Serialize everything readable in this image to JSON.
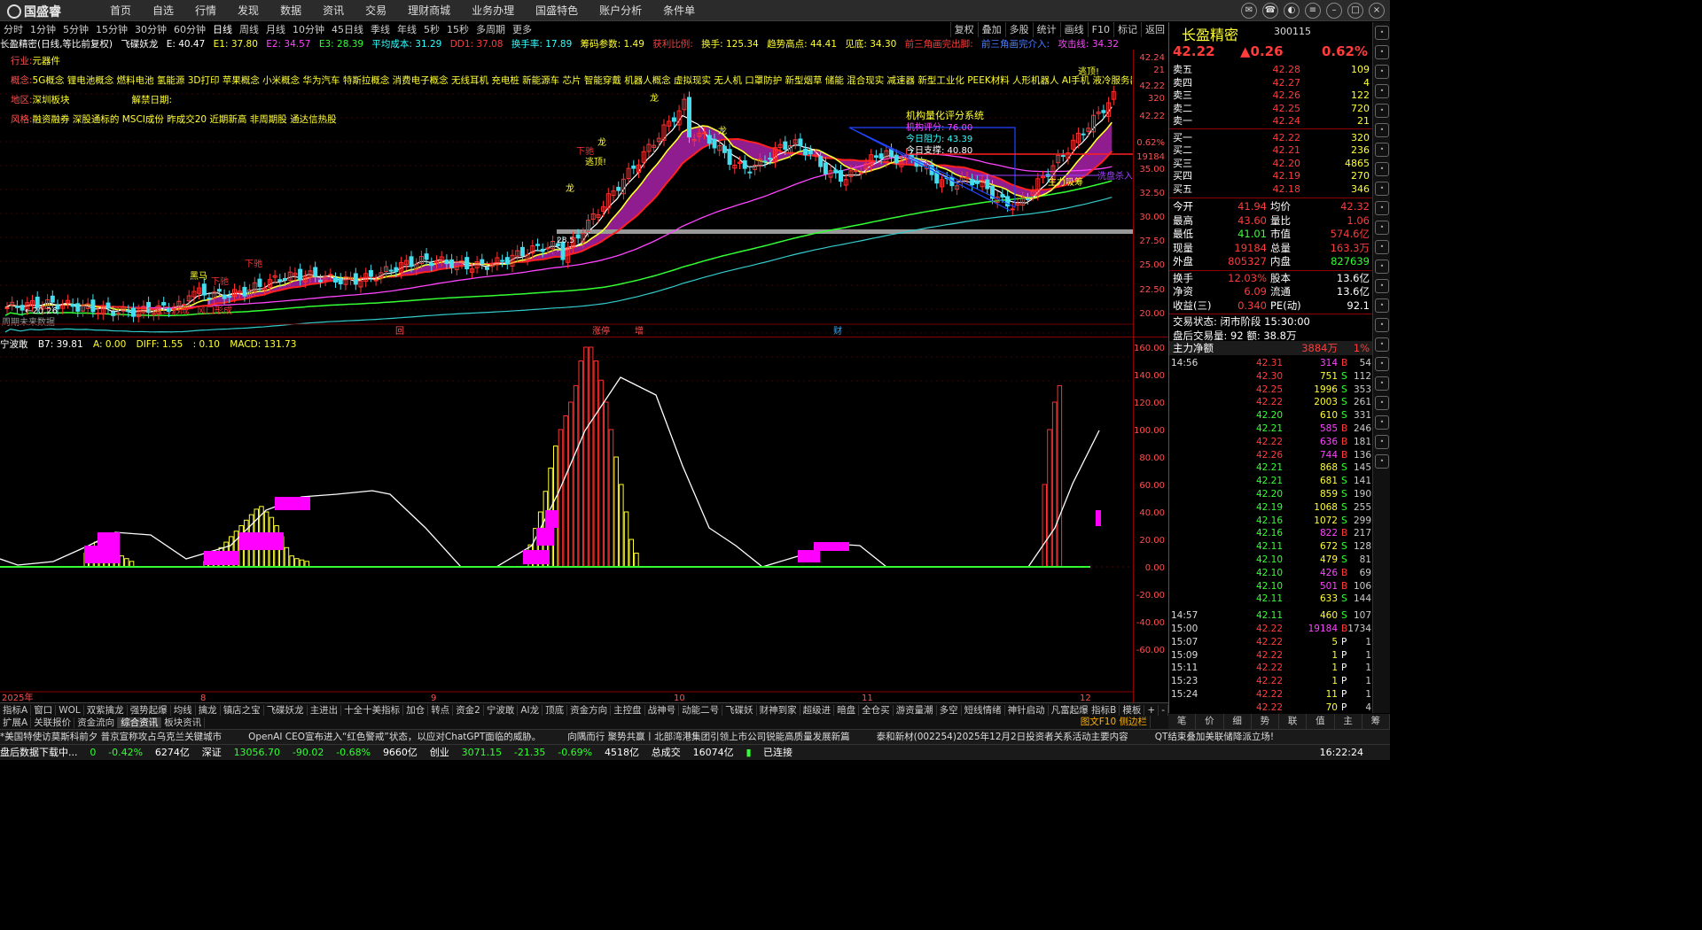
{
  "app": {
    "logo": "国盛睿"
  },
  "menu": [
    "首页",
    "自选",
    "行情",
    "发现",
    "数据",
    "资讯",
    "交易",
    "理财商城",
    "业务办理",
    "国盛特色",
    "账户分析",
    "条件单"
  ],
  "periods": [
    "分时",
    "1分钟",
    "5分钟",
    "15分钟",
    "30分钟",
    "60分钟",
    "日线",
    "周线",
    "月线",
    "10分钟",
    "45日线",
    "季线",
    "年线",
    "5秒",
    "15秒",
    "多周期",
    "更多"
  ],
  "active_period": "日线",
  "chart_tools": [
    "复权",
    "叠加",
    "多股",
    "统计",
    "画线",
    "F10",
    "标记",
    "返回"
  ],
  "info": {
    "stock": "长盈精密(日线,等比前复权)",
    "indicator": "飞碟妖龙",
    "e": "E: 40.47",
    "e1": "E1: 37.80",
    "e2": "E2: 34.57",
    "e3": "E3: 28.39",
    "avg_cost": "平均成本: 31.29",
    "dd1": "DD1: 37.08",
    "turnover_rate": "换手率: 17.89",
    "chip": "筹码参数: 1.49",
    "profit": "获利比例:",
    "turnover": "换手: 125.34",
    "trend_high": "趋势高点: 44.41",
    "vision": "见底: 34.30",
    "brk": "前三角画完出脚:",
    "brk2": "前三角画完介入:",
    "attack": "攻击线: 34.32"
  },
  "tags": {
    "industry_k": "行业:",
    "industry_v": "元器件",
    "concept_k": "概念:",
    "concept_v": "5G概念 锂电池概念 燃料电池 氢能源 3D打印 苹果概念 小米概念 华为汽车 特斯拉概念 消费电子概念 无线耳机 充电桩 新能源车 芯片 智能穿戴 机器人概念 虚拟现实 无人机 口罩防护 新型烟草 储能 混合现实 减速器 新型工业化 PEEK材料 人形机器人 AI手机 液冷服务器",
    "region_k": "地区:",
    "region_v": "深圳板块",
    "unlock_k": "解禁日期:",
    "style_k": "风格:",
    "style_v": "融资融券 深股通标的 MSCI成份 昨成交20 近期新高 非周期股 通达信热股"
  },
  "annotations": {
    "score_title": "机构量化评分系统",
    "score": "机构评分: 76.00",
    "resist": "今日阻力: 43.39",
    "support": "今日支撑: 40.80",
    "lbl_long": "龙",
    "lbl_cash": "逃顶!",
    "lbl_buy": "主力吸筹",
    "lbl_wash": "洗盘杀入",
    "lbl_dragon2": "下驰",
    "lbl_horse": "黑马",
    "lbl_low": "↑风口形成",
    "lbl_low2": "风口形成",
    "low_price": "←20.26",
    "p28": "28.5",
    "future": "周期未来数据",
    "evt1": "回",
    "evt2": "涨停",
    "evt3": "增",
    "evt4": "财"
  },
  "price_axis": [
    "42.24",
    "21",
    "42.22",
    "320",
    "42.22",
    "0.62%",
    "19184",
    "35.00",
    "32.50",
    "30.00",
    "27.50",
    "25.00",
    "22.50",
    "20.00"
  ],
  "macd_axis": [
    "160.00",
    "140.00",
    "120.00",
    "100.00",
    "80.00",
    "60.00",
    "40.00",
    "20.00",
    "0.00",
    "-20.00",
    "-40.00",
    "-60.00"
  ],
  "x_axis": [
    "2025年",
    "8",
    "9",
    "10",
    "11",
    "12"
  ],
  "x_axis_end": "日线",
  "macd_info": {
    "name": "宁波敢",
    "b7": "B7: 39.81",
    "a": "A: 0.00",
    "diff": "DIFF: 1.55",
    "dea": ": 0.10",
    "macd": "MACD: 131.73"
  },
  "tabs1": [
    "指标A",
    "窗口",
    "WOL",
    "双紫擒龙",
    "强势起爆",
    "均线",
    "擒龙",
    "镇店之宝",
    "飞碟妖龙",
    "主进出",
    "十全十美指标",
    "加仓",
    "转点",
    "资金2",
    "宁波敢",
    "AI龙",
    "顶底",
    "资金方向",
    "主控盘",
    "战神号",
    "动能二号",
    "飞碟妖",
    "财神到家",
    "超级进",
    "暗盘",
    "全仓买",
    "游资量潮",
    "多空",
    "短线情绪",
    "神针启动",
    "凡富起爆",
    "波段王"
  ],
  "tabs1_right": [
    "指标B",
    "模板",
    "+",
    "-"
  ],
  "tabs2": [
    "扩展A",
    "关联报价",
    "资金流向",
    "综合资讯",
    "板块资讯"
  ],
  "tabs2_right": "图文F10 侧边栏",
  "ticker": [
    "*美国特使访莫斯科前夕 普京宣称攻占乌克兰关键城市",
    "OpenAI CEO宣布进入“红色警戒”状态，以应对ChatGPT面临的威胁。",
    "向隅而行 聚势共赢丨北部湾港集团引领上市公司锐能高质量发展新篇",
    "泰和新材(002254)2025年12月2日投资者关系活动主要内容",
    "QT结束叠加美联储降派立场!"
  ],
  "status": {
    "left": "盘后数据下载中...",
    "sh_val": "0",
    "sh_pct": "-0.42%",
    "sh_amt": "6274亿",
    "sz_name": "深证",
    "sz_val": "13056.70",
    "sz_chg": "-90.02",
    "sz_pct": "-0.68%",
    "sz_amt": "9660亿",
    "cy_name": "创业",
    "cy_val": "3071.15",
    "cy_chg": "-21.35",
    "cy_pct": "-0.69%",
    "cy_amt": "4518亿",
    "total_k": "总成交",
    "total_v": "16074亿",
    "conn": "已连接",
    "time": "16:22:24"
  },
  "quote": {
    "name": "长盈精密",
    "code": "300115",
    "price": "42.22",
    "change": "▲0.26",
    "pct": "0.62%",
    "asks": [
      [
        "卖五",
        "42.28",
        "109"
      ],
      [
        "卖四",
        "42.27",
        "4"
      ],
      [
        "卖三",
        "42.26",
        "122"
      ],
      [
        "卖二",
        "42.25",
        "720"
      ],
      [
        "卖一",
        "42.24",
        "21"
      ]
    ],
    "bids": [
      [
        "买一",
        "42.22",
        "320"
      ],
      [
        "买二",
        "42.21",
        "236"
      ],
      [
        "买三",
        "42.20",
        "4865"
      ],
      [
        "买四",
        "42.19",
        "270"
      ],
      [
        "买五",
        "42.18",
        "346"
      ]
    ],
    "stats": [
      [
        "今开",
        "41.94",
        "均价",
        "42.32"
      ],
      [
        "最高",
        "43.60",
        "量比",
        "1.06"
      ],
      [
        "最低",
        "41.01",
        "市值",
        "574.6亿"
      ],
      [
        "现量",
        "19184",
        "总量",
        "163.3万"
      ],
      [
        "外盘",
        "805327",
        "内盘",
        "827639"
      ],
      [
        "换手",
        "12.03%",
        "股本",
        "13.6亿"
      ],
      [
        "净资",
        "6.09",
        "流通",
        "13.6亿"
      ],
      [
        "收益(三)",
        "0.340",
        "PE(动)",
        "92.1"
      ]
    ],
    "trade_state": "交易状态: 闭市阶段 15:30:00",
    "after_hours": "盘后交易量: 92  额: 38.8万",
    "main_flow_k": "主力净额",
    "main_flow_v": "3884万",
    "main_flow_pct": "1%"
  },
  "ticks": [
    [
      "14:56",
      "42.31",
      "314",
      "B",
      "54"
    ],
    [
      "",
      "42.30",
      "751",
      "S",
      "112"
    ],
    [
      "",
      "42.25",
      "1996",
      "S",
      "353"
    ],
    [
      "",
      "42.22",
      "2003",
      "S",
      "261"
    ],
    [
      "",
      "42.20",
      "610",
      "S",
      "331"
    ],
    [
      "",
      "42.21",
      "585",
      "B",
      "246"
    ],
    [
      "",
      "42.22",
      "636",
      "B",
      "181"
    ],
    [
      "",
      "42.26",
      "744",
      "B",
      "136"
    ],
    [
      "",
      "42.21",
      "868",
      "S",
      "145"
    ],
    [
      "",
      "42.21",
      "681",
      "S",
      "141"
    ],
    [
      "",
      "42.20",
      "859",
      "S",
      "190"
    ],
    [
      "",
      "42.19",
      "1068",
      "S",
      "255"
    ],
    [
      "",
      "42.16",
      "1072",
      "S",
      "299"
    ],
    [
      "",
      "42.16",
      "822",
      "B",
      "217"
    ],
    [
      "",
      "42.11",
      "672",
      "S",
      "128"
    ],
    [
      "",
      "42.10",
      "479",
      "S",
      "81"
    ],
    [
      "",
      "42.10",
      "426",
      "B",
      "69"
    ],
    [
      "",
      "42.10",
      "501",
      "B",
      "106"
    ],
    [
      "",
      "42.11",
      "633",
      "S",
      "144"
    ],
    [
      "14:57",
      "42.11",
      "460",
      "S",
      "107"
    ],
    [
      "15:00",
      "42.22",
      "19184",
      "B",
      "1734"
    ],
    [
      "15:07",
      "42.22",
      "5",
      "P",
      "1"
    ],
    [
      "15:09",
      "42.22",
      "1",
      "P",
      "1"
    ],
    [
      "15:11",
      "42.22",
      "1",
      "P",
      "1"
    ],
    [
      "15:23",
      "42.22",
      "1",
      "P",
      "1"
    ],
    [
      "15:24",
      "42.22",
      "11",
      "P",
      "1"
    ],
    [
      "",
      "42.22",
      "70",
      "P",
      "4"
    ]
  ],
  "rp_tabs": [
    "笔",
    "价",
    "细",
    "势",
    "联",
    "值",
    "主",
    "筹"
  ],
  "sidebar_icons": [
    "search",
    "chart",
    "star",
    "news",
    "info",
    "grid",
    "bell",
    "flow",
    "rsi",
    "set",
    "user",
    "list",
    "doc",
    "help",
    "ai",
    "mail",
    "tool",
    "more",
    "hot",
    "top",
    "up",
    "down",
    "end"
  ],
  "colors": {
    "up": "#ff3b3b",
    "down": "#33ff33",
    "accent": "#ffff33"
  }
}
